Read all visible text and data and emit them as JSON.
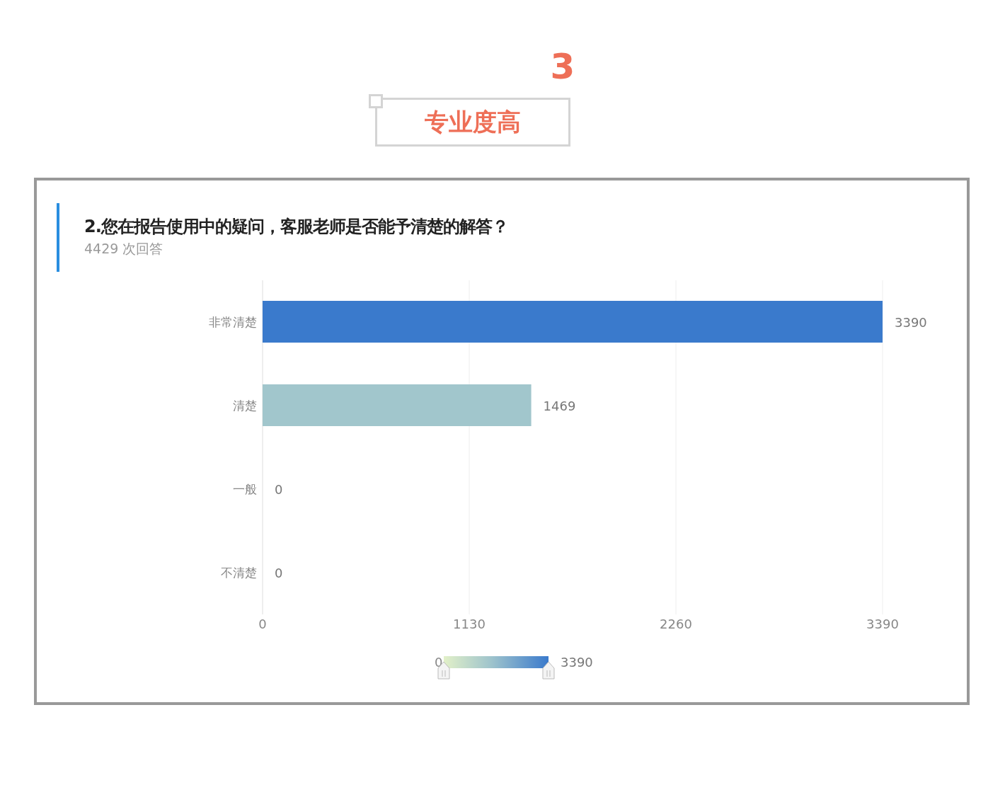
{
  "section": {
    "number": "3",
    "label": "专业度高"
  },
  "question": {
    "title": "2.您在报告使用中的疑问，客服老师是否能予清楚的解答？",
    "responses": "4429 次回答"
  },
  "chart": {
    "chart_data": {
      "type": "bar",
      "orientation": "horizontal",
      "categories": [
        "非常清楚",
        "清楚",
        "一般",
        "不清楚"
      ],
      "values": [
        3390,
        1469,
        0,
        0
      ],
      "xlim": [
        0,
        3390
      ],
      "xticks": [
        0,
        1130,
        2260,
        3390
      ],
      "data_labels": true
    },
    "visual_map": {
      "min_label": "0",
      "max_label": "3390"
    }
  }
}
